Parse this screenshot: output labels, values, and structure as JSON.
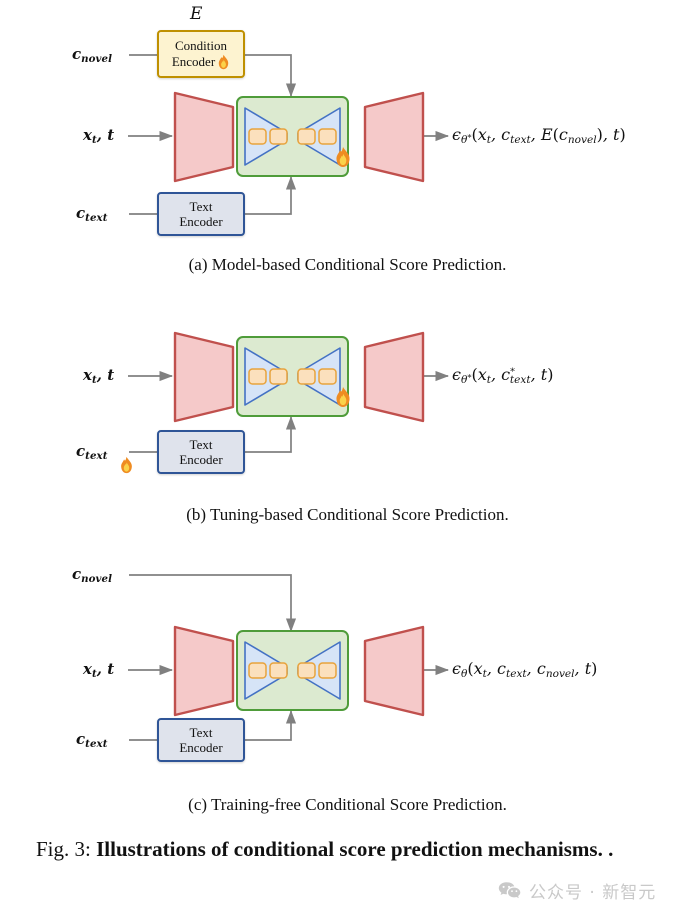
{
  "figure": {
    "caption_prefix": "Fig. 3:",
    "caption_bold": "Illustrations of conditional score prediction mechanisms.",
    "caption_suffix": "."
  },
  "watermark": {
    "icon": "wechat-icon",
    "text": "公众号 · 新智元"
  },
  "panels": [
    {
      "id": "a",
      "subcaption": "(a) Model-based Conditional Score Prediction.",
      "inputs": {
        "novel_label": "c",
        "novel_sub": "novel",
        "noisy_label": "x",
        "noisy_sub": "t",
        "noisy_rest": ", t",
        "text_label": "c",
        "text_sub": "text"
      },
      "cond_encoder": {
        "title": "E",
        "line1": "Condition",
        "line2": "Encoder",
        "flame": true
      },
      "text_encoder": {
        "line1": "Text",
        "line2": "Encoder",
        "flame": false
      },
      "unet_flame": true,
      "ctext_flame": false,
      "output": {
        "eps": "ϵ",
        "eps_sub": "θ*",
        "args": "(x_t, c_text, E(c_novel), t)",
        "plain": "ϵθ*(xt, ctext, E(cnovel), t)"
      }
    },
    {
      "id": "b",
      "subcaption": "(b) Tuning-based Conditional Score Prediction.",
      "inputs": {
        "noisy_label": "x",
        "noisy_sub": "t",
        "noisy_rest": ", t",
        "text_label": "c",
        "text_sub": "text"
      },
      "text_encoder": {
        "line1": "Text",
        "line2": "Encoder",
        "flame": false
      },
      "unet_flame": true,
      "ctext_flame": true,
      "output": {
        "eps": "ϵ",
        "eps_sub": "θ*",
        "args": "(x_t, c*_text, t)",
        "plain": "ϵθ*(xt, c*text, t)"
      }
    },
    {
      "id": "c",
      "subcaption": "(c) Training-free Conditional Score Prediction.",
      "inputs": {
        "novel_label": "c",
        "novel_sub": "novel",
        "noisy_label": "x",
        "noisy_sub": "t",
        "noisy_rest": ", t",
        "text_label": "c",
        "text_sub": "text"
      },
      "text_encoder": {
        "line1": "Text",
        "line2": "Encoder",
        "flame": false
      },
      "unet_flame": false,
      "ctext_flame": false,
      "output": {
        "eps": "ϵ",
        "eps_sub": "θ",
        "args": "(x_t, c_text, c_novel, t)",
        "plain": "ϵθ(xt, ctext, cnovel, t)"
      }
    }
  ],
  "colors": {
    "trapezoid_fill": "#f5c9c9",
    "trapezoid_stroke": "#c0504d",
    "unet_fill": "#dcead0",
    "unet_stroke": "#4f9c3a",
    "triangle_fill": "#d6e4f7",
    "triangle_stroke": "#4472c4",
    "block_fill": "#fbe0bd",
    "block_stroke": "#e8a33d",
    "cond_encoder_fill": "#fdf3d0",
    "cond_encoder_stroke": "#bf9000",
    "text_encoder_fill": "#dfe3ec",
    "text_encoder_stroke": "#2f5597",
    "wire": "#808080",
    "watermark": "#c9c9c9"
  }
}
